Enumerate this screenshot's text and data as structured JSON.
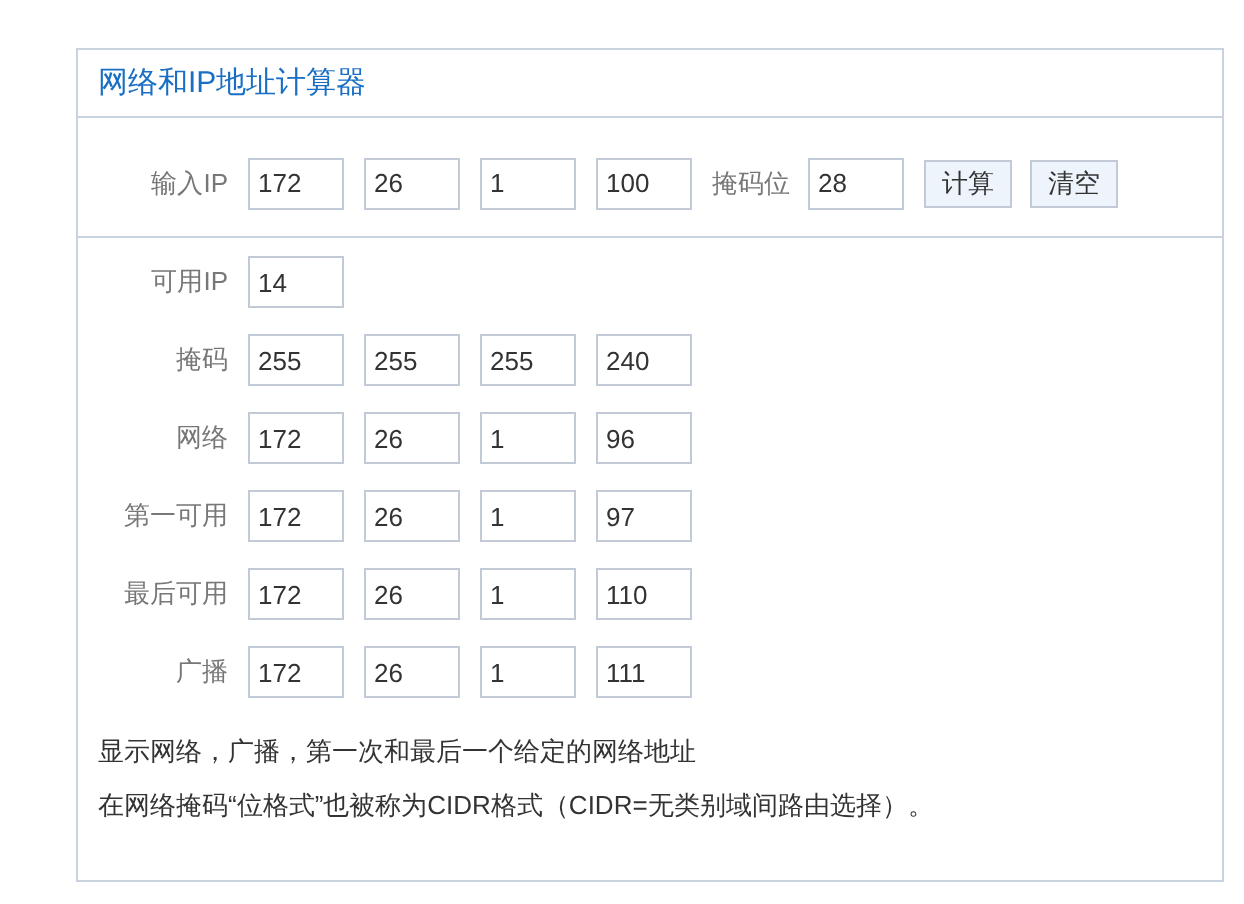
{
  "title": "网络和IP地址计算器",
  "input": {
    "label": "输入IP",
    "octets": [
      "172",
      "26",
      "1",
      "100"
    ],
    "mask_label": "掩码位",
    "mask_bits": "28"
  },
  "buttons": [
    "计算",
    "清空"
  ],
  "results": [
    {
      "label": "可用IP",
      "values": [
        "14"
      ]
    },
    {
      "label": "掩码",
      "values": [
        "255",
        "255",
        "255",
        "240"
      ]
    },
    {
      "label": "网络",
      "values": [
        "172",
        "26",
        "1",
        "96"
      ]
    },
    {
      "label": "第一可用",
      "values": [
        "172",
        "26",
        "1",
        "97"
      ]
    },
    {
      "label": "最后可用",
      "values": [
        "172",
        "26",
        "1",
        "110"
      ]
    },
    {
      "label": "广播",
      "values": [
        "172",
        "26",
        "1",
        "111"
      ]
    }
  ],
  "notes": [
    "显示网络，广播，第一次和最后一个给定的网络地址",
    "在网络掩码“位格式”也被称为CIDR格式（CIDR=无类别域间路由选择）。"
  ]
}
